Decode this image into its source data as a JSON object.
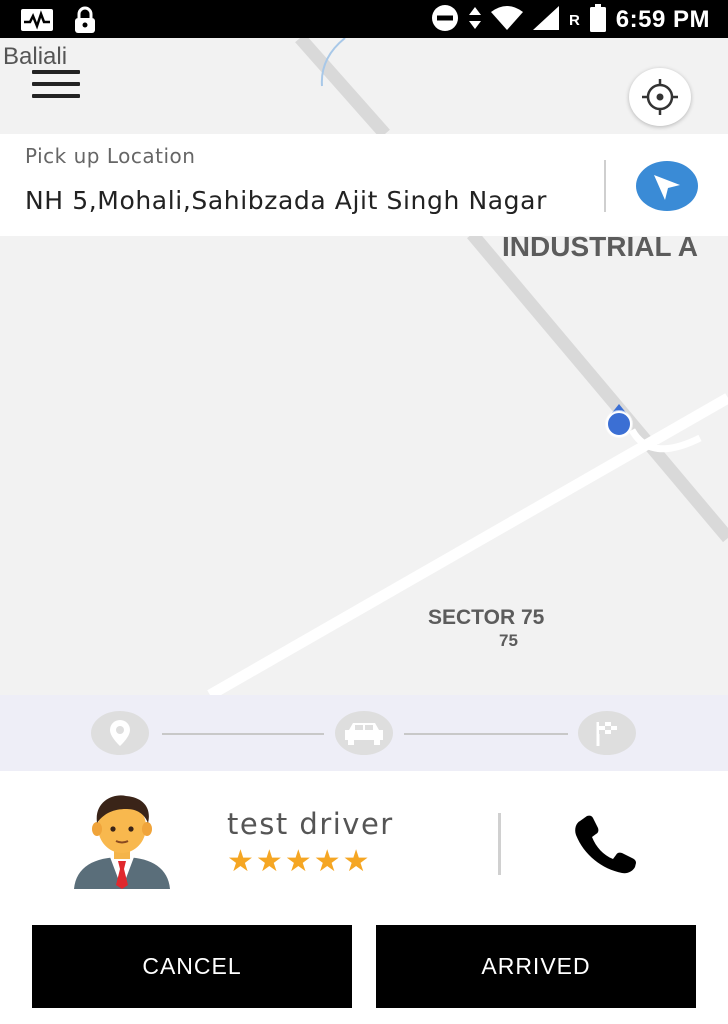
{
  "status_bar": {
    "time": "6:59 PM",
    "roaming": "R",
    "icons": [
      "activity-monitor-icon",
      "lock-icon",
      "do-not-disturb-icon",
      "data-arrows-icon",
      "wifi-icon",
      "signal-icon",
      "battery-icon"
    ]
  },
  "app": {
    "name": "Baliali"
  },
  "map": {
    "area_label": "INDUSTRIAL A",
    "sector_label": "SECTOR 75",
    "sector_number": "75"
  },
  "pickup": {
    "label": "Pick up Location",
    "address": "NH 5,Mohali,Sahibzada Ajit Singh Nagar"
  },
  "trip_progress": {
    "steps": [
      "pickup-location-icon",
      "car-icon",
      "finish-flag-icon"
    ]
  },
  "driver": {
    "name": "test driver",
    "rating_stars": 5,
    "stars": [
      "★",
      "★",
      "★",
      "★",
      "★"
    ]
  },
  "actions": {
    "cancel_label": "CANCEL",
    "arrived_label": "ARRIVED"
  },
  "colors": {
    "accent_blue": "#3a8bd6",
    "star": "#f5a623",
    "button_bg": "#000000",
    "progress_bg": "#eeeef7"
  }
}
